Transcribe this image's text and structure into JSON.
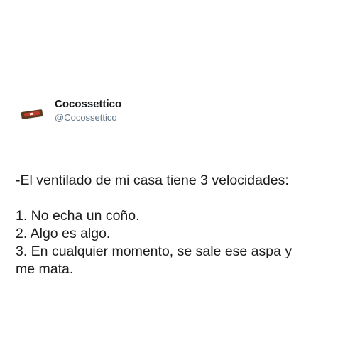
{
  "tweet": {
    "author": {
      "display_name": "Cocossettico",
      "handle": "@Cocossettico",
      "avatar_icon": "chocolate-bar-avatar-icon"
    },
    "text": {
      "intro": "-El ventilado de mi casa tiene 3 velocidades:",
      "item_1": "1. No echa un coño.",
      "item_2": "2. Algo es algo.",
      "item_3_line_1": "3. En cualquier momento, se sale ese aspa y",
      "item_3_line_2": "me mata."
    }
  },
  "colors": {
    "background": "#ffffff",
    "name": "#14171a",
    "handle": "#657786",
    "text": "#1c1c1c"
  }
}
